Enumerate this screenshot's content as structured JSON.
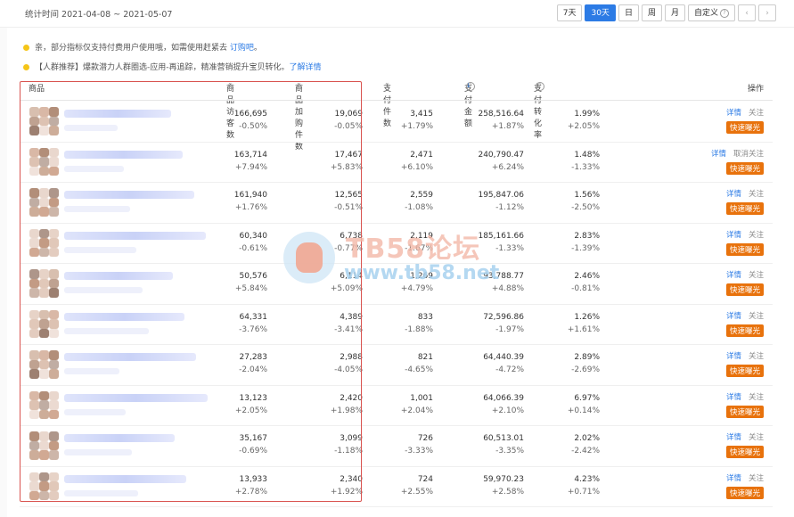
{
  "stat_time": "统计时间 2021-04-08 ~ 2021-05-07",
  "range_buttons": [
    "7天",
    "30天",
    "日",
    "周",
    "月",
    "自定义"
  ],
  "active_range": "30天",
  "notice1": {
    "text": "亲，部分指标仅支持付费用户使用哦，如需使用赶紧去 ",
    "link": "订购吧",
    "after": "。"
  },
  "notice2": {
    "text": "【人群推荐】爆款潜力人群圈选-应用-再追踪，精准营销提升宝贝转化。",
    "link": "了解详情"
  },
  "columns": {
    "product": "商品",
    "visitors": "商品访客数",
    "carts": "商品加购件数",
    "pay_items": "支付件数",
    "pay_amount": "支付金额",
    "conv": "支付转化率",
    "ops": "操作"
  },
  "rows": [
    {
      "visitors": "166,695",
      "visitors_d": "-0.50%",
      "carts": "19,069",
      "carts_d": "-0.05%",
      "pay_items": "3,415",
      "pay_items_d": "+1.79%",
      "amount": "258,516.64",
      "amount_d": "+1.87%",
      "conv": "1.99%",
      "conv_d": "+2.05%",
      "detail": "详情",
      "follow": "关注",
      "fast": "快速曝光"
    },
    {
      "visitors": "163,714",
      "visitors_d": "+7.94%",
      "carts": "17,467",
      "carts_d": "+5.83%",
      "pay_items": "2,471",
      "pay_items_d": "+6.10%",
      "amount": "240,790.47",
      "amount_d": "+6.24%",
      "conv": "1.48%",
      "conv_d": "-1.33%",
      "detail": "详情",
      "follow": "取消关注",
      "fast": "快速曝光"
    },
    {
      "visitors": "161,940",
      "visitors_d": "+1.76%",
      "carts": "12,565",
      "carts_d": "-0.51%",
      "pay_items": "2,559",
      "pay_items_d": "-1.08%",
      "amount": "195,847.06",
      "amount_d": "-1.12%",
      "conv": "1.56%",
      "conv_d": "-2.50%",
      "detail": "详情",
      "follow": "关注",
      "fast": "快速曝光"
    },
    {
      "visitors": "60,340",
      "visitors_d": "-0.61%",
      "carts": "6,738",
      "carts_d": "-0.77%",
      "pay_items": "2,119",
      "pay_items_d": "-1.67%",
      "amount": "185,161.66",
      "amount_d": "-1.33%",
      "conv": "2.83%",
      "conv_d": "-1.39%",
      "detail": "详情",
      "follow": "关注",
      "fast": "快速曝光"
    },
    {
      "visitors": "50,576",
      "visitors_d": "+5.84%",
      "carts": "6,114",
      "carts_d": "+5.09%",
      "pay_items": "1,269",
      "pay_items_d": "+4.79%",
      "amount": "93,788.77",
      "amount_d": "+4.88%",
      "conv": "2.46%",
      "conv_d": "-0.81%",
      "detail": "详情",
      "follow": "关注",
      "fast": "快速曝光"
    },
    {
      "visitors": "64,331",
      "visitors_d": "-3.76%",
      "carts": "4,389",
      "carts_d": "-3.41%",
      "pay_items": "833",
      "pay_items_d": "-1.88%",
      "amount": "72,596.86",
      "amount_d": "-1.97%",
      "conv": "1.26%",
      "conv_d": "+1.61%",
      "detail": "详情",
      "follow": "关注",
      "fast": "快速曝光"
    },
    {
      "visitors": "27,283",
      "visitors_d": "-2.04%",
      "carts": "2,988",
      "carts_d": "-4.05%",
      "pay_items": "821",
      "pay_items_d": "-4.65%",
      "amount": "64,440.39",
      "amount_d": "-4.72%",
      "conv": "2.89%",
      "conv_d": "-2.69%",
      "detail": "详情",
      "follow": "关注",
      "fast": "快速曝光"
    },
    {
      "visitors": "13,123",
      "visitors_d": "+2.05%",
      "carts": "2,420",
      "carts_d": "+1.98%",
      "pay_items": "1,001",
      "pay_items_d": "+2.04%",
      "amount": "64,066.39",
      "amount_d": "+2.10%",
      "conv": "6.97%",
      "conv_d": "+0.14%",
      "detail": "详情",
      "follow": "关注",
      "fast": "快速曝光"
    },
    {
      "visitors": "35,167",
      "visitors_d": "-0.69%",
      "carts": "3,099",
      "carts_d": "-1.18%",
      "pay_items": "726",
      "pay_items_d": "-3.33%",
      "amount": "60,513.01",
      "amount_d": "-3.35%",
      "conv": "2.02%",
      "conv_d": "-2.42%",
      "detail": "详情",
      "follow": "关注",
      "fast": "快速曝光"
    },
    {
      "visitors": "13,933",
      "visitors_d": "+2.78%",
      "carts": "2,340",
      "carts_d": "+1.92%",
      "pay_items": "724",
      "pay_items_d": "+2.55%",
      "amount": "59,970.23",
      "amount_d": "+2.58%",
      "conv": "4.23%",
      "conv_d": "+0.71%",
      "detail": "详情",
      "follow": "关注",
      "fast": "快速曝光"
    }
  ],
  "watermark": {
    "line1": "TB58论坛",
    "line2": "www.tb58.net"
  }
}
